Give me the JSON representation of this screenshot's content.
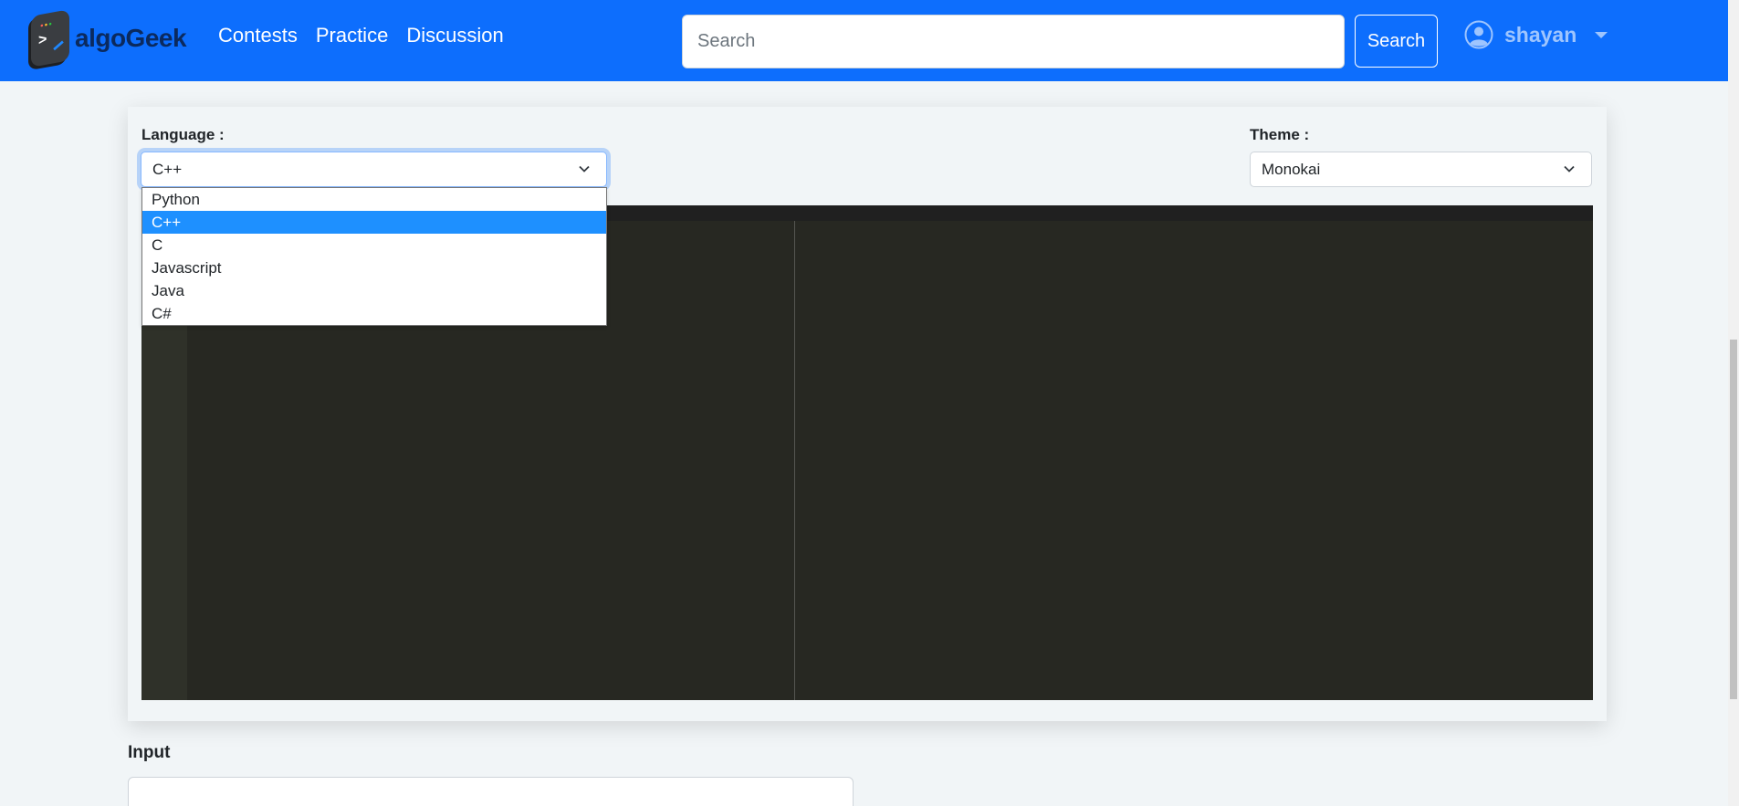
{
  "navbar": {
    "brand": "algoGeek",
    "links": [
      "Contests",
      "Practice",
      "Discussion"
    ],
    "search": {
      "placeholder": "Search",
      "value": "",
      "button_label": "Search"
    },
    "user": {
      "name": "shayan",
      "icon": "user-circle-icon"
    },
    "colors": {
      "background": "#0d6efd",
      "user_text": "#9ec5fe"
    }
  },
  "editor_panel": {
    "language": {
      "label": "Language :",
      "selected": "C++",
      "options": [
        "Python",
        "C++",
        "C",
        "Javascript",
        "Java",
        "C#"
      ],
      "dropdown_open": true,
      "highlight_color": "#1e90ff"
    },
    "theme": {
      "label": "Theme :",
      "selected": "Monokai"
    },
    "code": ""
  },
  "input_section": {
    "label": "Input",
    "value": ""
  }
}
